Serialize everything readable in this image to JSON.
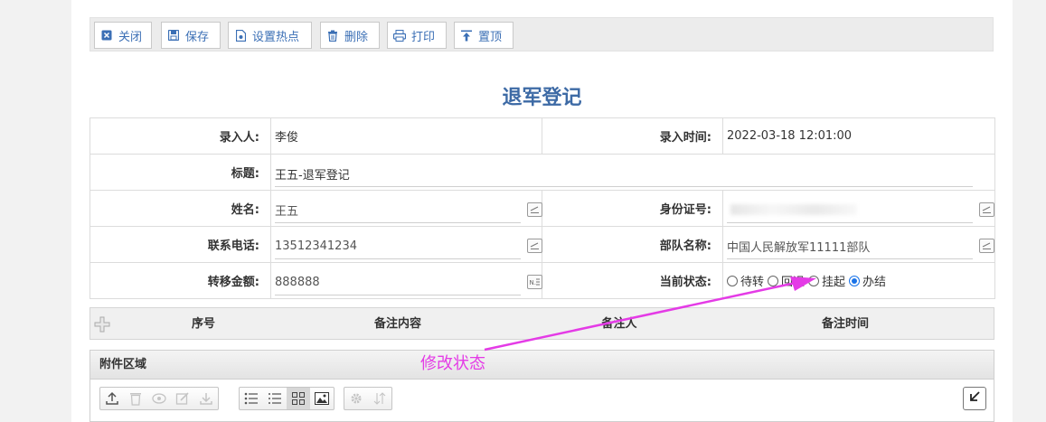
{
  "toolbar": {
    "close": "关闭",
    "save": "保存",
    "hotspot": "设置热点",
    "delete": "删除",
    "print": "打印",
    "pin": "置顶"
  },
  "form": {
    "title": "退军登记",
    "rows": {
      "entered_by_label": "录入人:",
      "entered_by": "李俊",
      "entry_time_label": "录入时间:",
      "entry_time": "2022-03-18 12:01:00",
      "subject_label": "标题:",
      "subject": "王五-退军登记",
      "name_label": "姓名:",
      "name": "王五",
      "id_label": "身份证号:",
      "id_value": "",
      "phone_label": "联系电话:",
      "phone": "13512341234",
      "unit_label": "部队名称:",
      "unit": "中国人民解放军11111部队",
      "amount_label": "转移金额:",
      "amount": "888888",
      "status_label": "当前状态:"
    },
    "status_options": [
      "待转",
      "回退",
      "挂起",
      "办结"
    ],
    "status_selected": "办结"
  },
  "grid": {
    "columns": [
      "序号",
      "备注内容",
      "备注人",
      "备注时间"
    ]
  },
  "attachments": {
    "title": "附件区域"
  },
  "annotation": {
    "text": "修改状态",
    "color": "#e43be6"
  },
  "colors": {
    "accent": "#3d6aa5",
    "toolbar_text": "#3b6fb5",
    "radio_selected": "#1a73e8"
  }
}
